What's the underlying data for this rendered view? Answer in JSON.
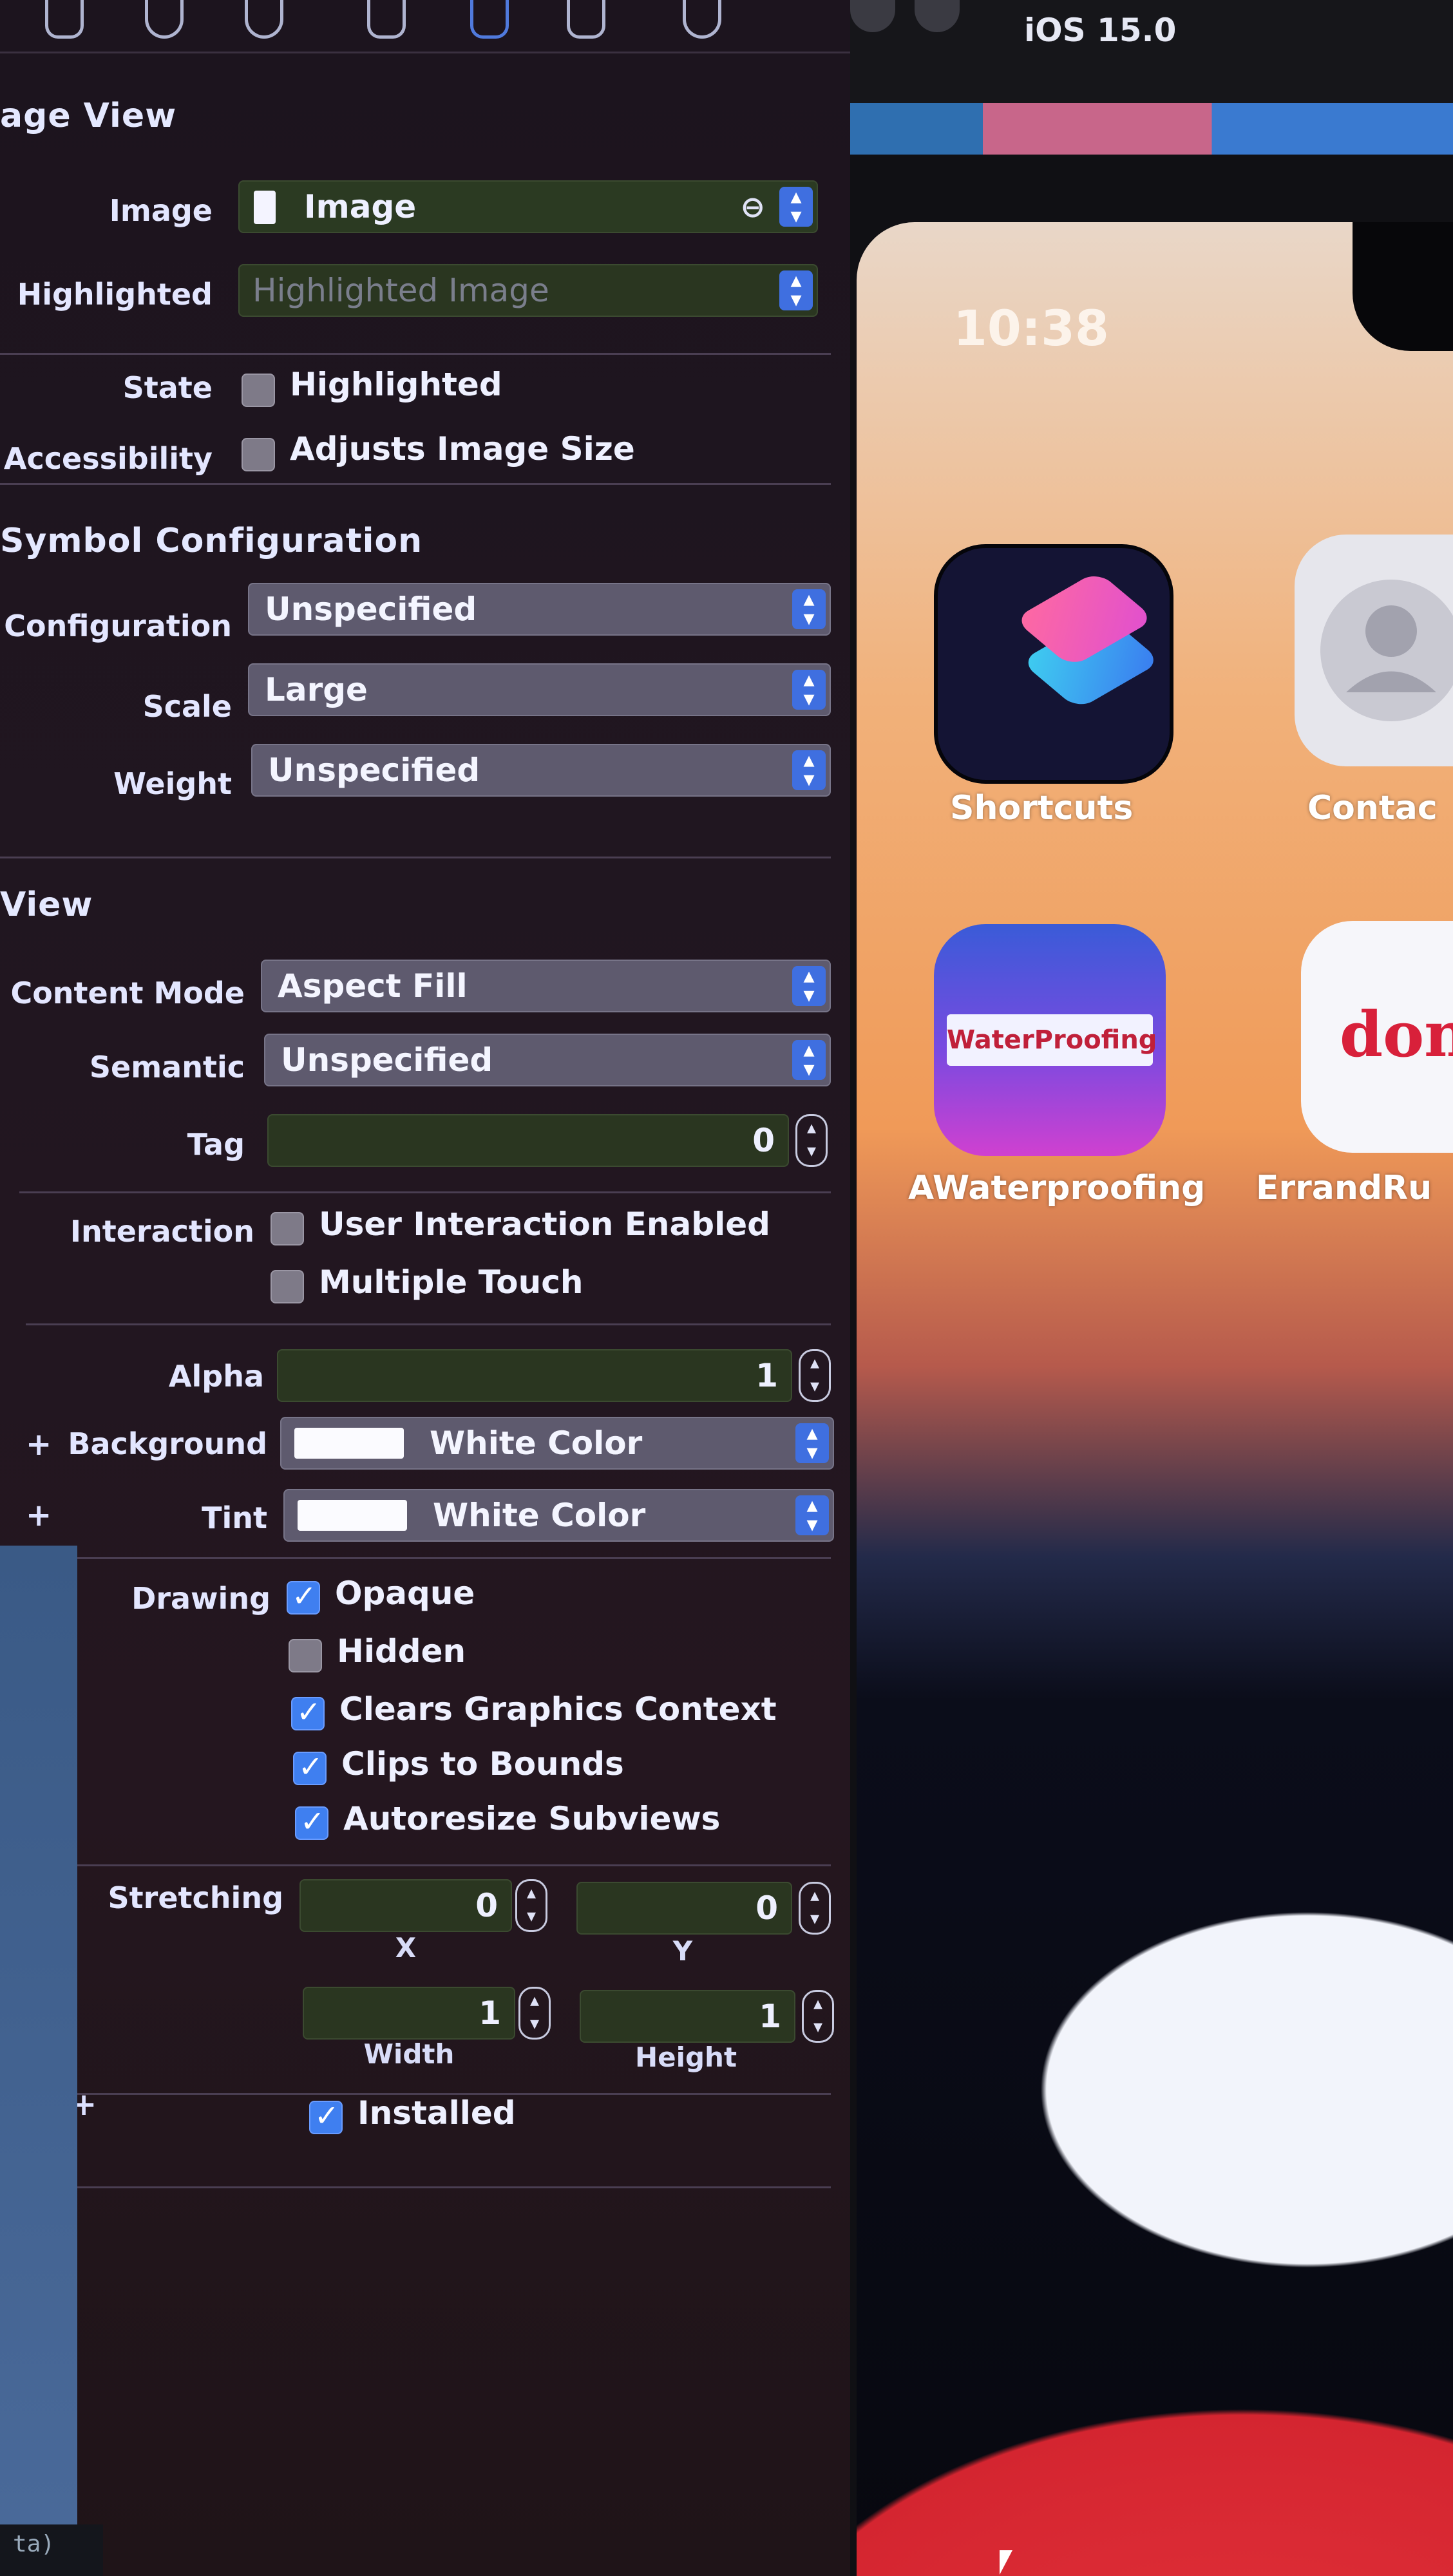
{
  "inspector": {
    "section_image_view": "age View",
    "image": {
      "label": "Image",
      "value": "Image"
    },
    "highlighted": {
      "label": "Highlighted",
      "placeholder": "Highlighted Image"
    },
    "state": {
      "label": "State",
      "checkbox_label": "Highlighted",
      "checked": false
    },
    "accessibility": {
      "label": "Accessibility",
      "checkbox_label": "Adjusts Image Size",
      "checked": false
    },
    "section_symbol": "Symbol Configuration",
    "configuration": {
      "label": "Configuration",
      "value": "Unspecified"
    },
    "scale": {
      "label": "Scale",
      "value": "Large"
    },
    "weight": {
      "label": "Weight",
      "value": "Unspecified"
    },
    "section_view": "View",
    "content_mode": {
      "label": "Content Mode",
      "value": "Aspect Fill"
    },
    "semantic": {
      "label": "Semantic",
      "value": "Unspecified"
    },
    "tag": {
      "label": "Tag",
      "value": "0"
    },
    "interaction": {
      "label": "Interaction",
      "user_interaction": {
        "label": "User Interaction Enabled",
        "checked": false
      },
      "multiple_touch": {
        "label": "Multiple Touch",
        "checked": false
      }
    },
    "alpha": {
      "label": "Alpha",
      "value": "1"
    },
    "background": {
      "label": "Background",
      "value": "White Color"
    },
    "tint": {
      "label": "Tint",
      "value": "White Color"
    },
    "drawing": {
      "label": "Drawing",
      "opaque": {
        "label": "Opaque",
        "checked": true
      },
      "hidden": {
        "label": "Hidden",
        "checked": false
      },
      "clears": {
        "label": "Clears Graphics Context",
        "checked": true
      },
      "clips": {
        "label": "Clips to Bounds",
        "checked": true
      },
      "autoresize": {
        "label": "Autoresize Subviews",
        "checked": true
      }
    },
    "stretching": {
      "label": "Stretching",
      "x": {
        "label": "X",
        "value": "0"
      },
      "y": {
        "label": "Y",
        "value": "0"
      },
      "width": {
        "label": "Width",
        "value": "1"
      },
      "height": {
        "label": "Height",
        "value": "1"
      }
    },
    "installed": {
      "label": "Installed",
      "checked": true
    },
    "plus_symbol": "+",
    "footer_fragment": "ta)"
  },
  "simulator": {
    "os_version": "iOS 15.0",
    "clock": "10:38",
    "apps": [
      {
        "label": "Shortcuts"
      },
      {
        "label": "Contac"
      },
      {
        "label": "AWaterproofing",
        "icon_text": "WaterProofing"
      },
      {
        "label": "ErrandRu",
        "icon_text": "done"
      }
    ]
  },
  "colors": {
    "panel_bg": "#1f1620",
    "accent_blue": "#3f7ff0",
    "field_bg": "#2a3620",
    "popup_bg": "#5e5a6e"
  }
}
